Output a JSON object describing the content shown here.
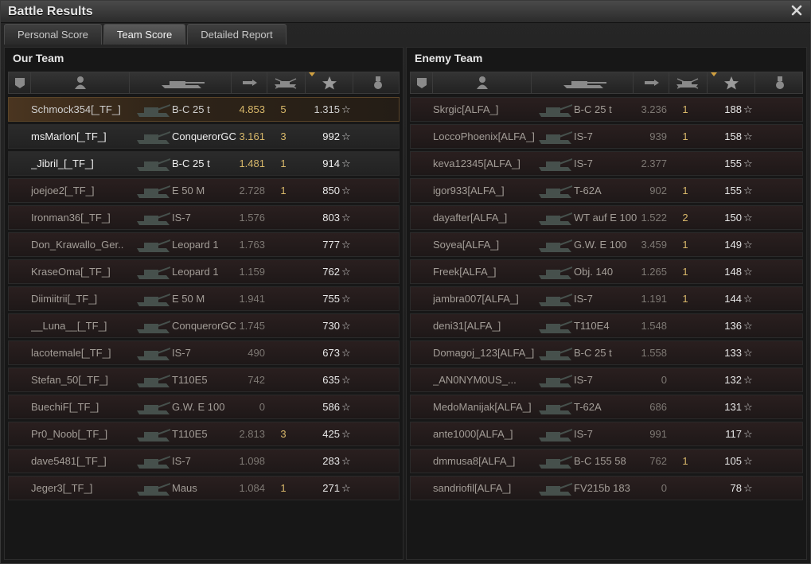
{
  "window": {
    "title": "Battle Results",
    "close_icon": "close-icon"
  },
  "tabs": [
    {
      "label": "Personal Score"
    },
    {
      "label": "Team Score"
    },
    {
      "label": "Detailed Report"
    }
  ],
  "our_team": {
    "title": "Our Team",
    "rows": [
      {
        "name": "Schmock354[_TF_]",
        "vehicle": "B-C 25 t",
        "damage": "4.853",
        "kills": "5",
        "xp": "1.315",
        "style": "self"
      },
      {
        "name": "msMarlon[_TF_]",
        "vehicle": "ConquerorGC",
        "damage": "3.161",
        "kills": "3",
        "xp": "992",
        "style": "own"
      },
      {
        "name": "_Jibril_[_TF_]",
        "vehicle": "B-C 25 t",
        "damage": "1.481",
        "kills": "1",
        "xp": "914",
        "style": "own"
      },
      {
        "name": "joejoe2[_TF_]",
        "vehicle": "E 50 M",
        "damage": "2.728",
        "kills": "1",
        "xp": "850",
        "style": "dim"
      },
      {
        "name": "Ironman36[_TF_]",
        "vehicle": "IS-7",
        "damage": "1.576",
        "kills": "",
        "xp": "803",
        "style": "dim"
      },
      {
        "name": "Don_Krawallo_Ger..",
        "vehicle": "Leopard 1",
        "damage": "1.763",
        "kills": "",
        "xp": "777",
        "style": "dim"
      },
      {
        "name": "KraseOma[_TF_]",
        "vehicle": "Leopard 1",
        "damage": "1.159",
        "kills": "",
        "xp": "762",
        "style": "dim"
      },
      {
        "name": "Diimiitrii[_TF_]",
        "vehicle": "E 50 M",
        "damage": "1.941",
        "kills": "",
        "xp": "755",
        "style": "dim"
      },
      {
        "name": "__Luna__[_TF_]",
        "vehicle": "ConquerorGC",
        "damage": "1.745",
        "kills": "",
        "xp": "730",
        "style": "dim"
      },
      {
        "name": "lacotemale[_TF_]",
        "vehicle": "IS-7",
        "damage": "490",
        "kills": "",
        "xp": "673",
        "style": "dim"
      },
      {
        "name": "Stefan_50[_TF_]",
        "vehicle": "T110E5",
        "damage": "742",
        "kills": "",
        "xp": "635",
        "style": "dim"
      },
      {
        "name": "BuechiF[_TF_]",
        "vehicle": "G.W. E 100",
        "damage": "0",
        "kills": "",
        "xp": "586",
        "style": "dim"
      },
      {
        "name": "Pr0_Noob[_TF_]",
        "vehicle": "T110E5",
        "damage": "2.813",
        "kills": "3",
        "xp": "425",
        "style": "dim"
      },
      {
        "name": "dave5481[_TF_]",
        "vehicle": "IS-7",
        "damage": "1.098",
        "kills": "",
        "xp": "283",
        "style": "dim"
      },
      {
        "name": "Jeger3[_TF_]",
        "vehicle": "Maus",
        "damage": "1.084",
        "kills": "1",
        "xp": "271",
        "style": "dim"
      }
    ]
  },
  "enemy_team": {
    "title": "Enemy Team",
    "rows": [
      {
        "name": "Skrgic[ALFA_]",
        "vehicle": "B-C 25 t",
        "damage": "3.236",
        "kills": "1",
        "xp": "188",
        "style": "dim"
      },
      {
        "name": "LoccoPhoenix[ALFA_]",
        "vehicle": "IS-7",
        "damage": "939",
        "kills": "1",
        "xp": "158",
        "style": "dim"
      },
      {
        "name": "keva12345[ALFA_]",
        "vehicle": "IS-7",
        "damage": "2.377",
        "kills": "",
        "xp": "155",
        "style": "dim"
      },
      {
        "name": "igor933[ALFA_]",
        "vehicle": "T-62A",
        "damage": "902",
        "kills": "1",
        "xp": "155",
        "style": "dim"
      },
      {
        "name": "dayafter[ALFA_]",
        "vehicle": "WT auf E 100",
        "damage": "1.522",
        "kills": "2",
        "xp": "150",
        "style": "dim"
      },
      {
        "name": "Soyea[ALFA_]",
        "vehicle": "G.W. E 100",
        "damage": "3.459",
        "kills": "1",
        "xp": "149",
        "style": "dim"
      },
      {
        "name": "Freek[ALFA_]",
        "vehicle": "Obj. 140",
        "damage": "1.265",
        "kills": "1",
        "xp": "148",
        "style": "dim"
      },
      {
        "name": "jambra007[ALFA_]",
        "vehicle": "IS-7",
        "damage": "1.191",
        "kills": "1",
        "xp": "144",
        "style": "dim"
      },
      {
        "name": "deni31[ALFA_]",
        "vehicle": "T110E4",
        "damage": "1.548",
        "kills": "",
        "xp": "136",
        "style": "dim"
      },
      {
        "name": "Domagoj_123[ALFA_]",
        "vehicle": "B-C 25 t",
        "damage": "1.558",
        "kills": "",
        "xp": "133",
        "style": "dim"
      },
      {
        "name": "_AN0NYM0US_...",
        "vehicle": "IS-7",
        "damage": "0",
        "kills": "",
        "xp": "132",
        "style": "dim"
      },
      {
        "name": "MedoManijak[ALFA_]",
        "vehicle": "T-62A",
        "damage": "686",
        "kills": "",
        "xp": "131",
        "style": "dim"
      },
      {
        "name": "ante1000[ALFA_]",
        "vehicle": "IS-7",
        "damage": "991",
        "kills": "",
        "xp": "117",
        "style": "dim"
      },
      {
        "name": "dmmusa8[ALFA_]",
        "vehicle": "B-C 155 58",
        "damage": "762",
        "kills": "1",
        "xp": "105",
        "style": "dim"
      },
      {
        "name": "sandriofil[ALFA_]",
        "vehicle": "FV215b 183",
        "damage": "0",
        "kills": "",
        "xp": "78",
        "style": "dim"
      }
    ]
  },
  "icons": {
    "platoon": "platoon-icon",
    "player": "player-icon",
    "vehicle": "tank-icon",
    "damage": "damage-icon",
    "kills": "kills-icon",
    "xp": "star-icon",
    "medal": "medal-icon"
  },
  "colors": {
    "accent_gold": "#d8b86a",
    "self_row": "#4a3520"
  }
}
